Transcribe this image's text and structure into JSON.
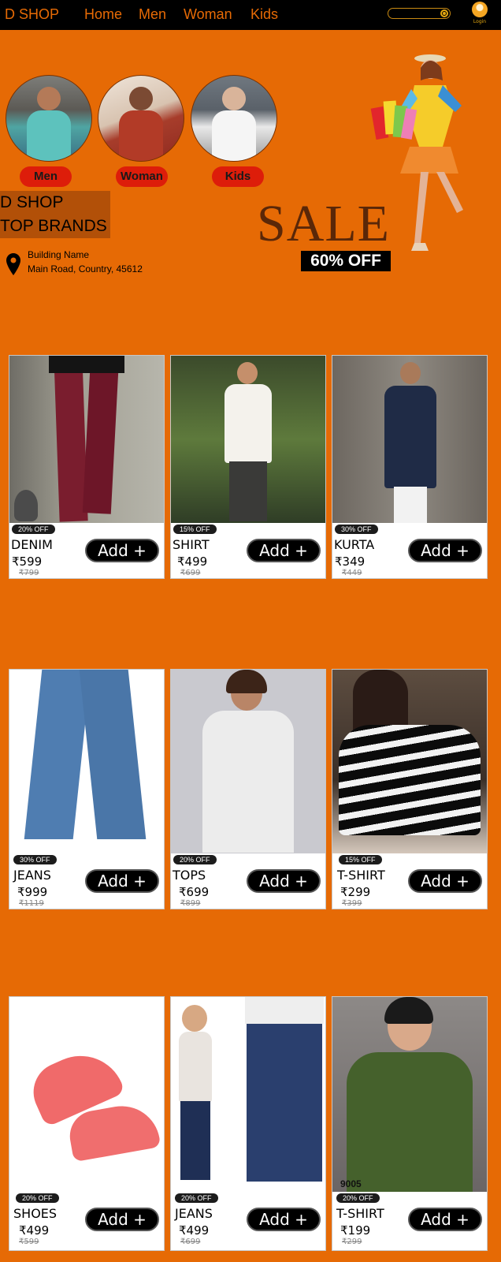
{
  "nav": {
    "brand": "D SHOP",
    "links": [
      "Home",
      "Men",
      "Woman",
      "Kids"
    ],
    "login_label": "Login"
  },
  "hero": {
    "categories": [
      "Men",
      "Woman",
      "Kids"
    ],
    "brand_lines": [
      "D SHOP",
      "TOP BRANDS"
    ],
    "address_lines": [
      "Building Name",
      "Main Road, Country, 45612"
    ],
    "sale_text": "SALE",
    "offer_text": "60% OFF"
  },
  "products": [
    {
      "badge": "20% OFF",
      "name": "DENIM",
      "price": "₹599",
      "old": "₹799",
      "add": "Add +"
    },
    {
      "badge": "15% OFF",
      "name": "SHIRT",
      "price": "₹499",
      "old": "₹699",
      "add": "Add +"
    },
    {
      "badge": "30% OFF",
      "name": "KURTA",
      "price": "₹349",
      "old": "₹449",
      "add": "Add +"
    },
    {
      "badge": "30% OFF",
      "name": "JEANS",
      "price": "₹999",
      "old": "₹1119",
      "add": "Add +"
    },
    {
      "badge": "20% OFF",
      "name": "TOPS",
      "price": "₹699",
      "old": "₹899",
      "add": "Add +"
    },
    {
      "badge": "15% OFF",
      "name": "T-SHIRT",
      "price": "₹299",
      "old": "₹399",
      "add": "Add +"
    },
    {
      "badge": "20% OFF",
      "name": "SHOES",
      "price": "₹499",
      "old": "₹599",
      "add": "Add +"
    },
    {
      "badge": "20% OFF",
      "name": "JEANS",
      "price": "₹499",
      "old": "₹699",
      "add": "Add +"
    },
    {
      "badge": "20% OFF",
      "name": "T-SHIRT",
      "price": "₹199",
      "old": "₹299",
      "add": "Add +"
    }
  ],
  "product_image_text": {
    "kids_tee_number": "9005"
  },
  "colors": {
    "background": "#e66a05",
    "nav": "#000000",
    "accent": "#e66a05",
    "category_button": "#dd1d0a"
  }
}
